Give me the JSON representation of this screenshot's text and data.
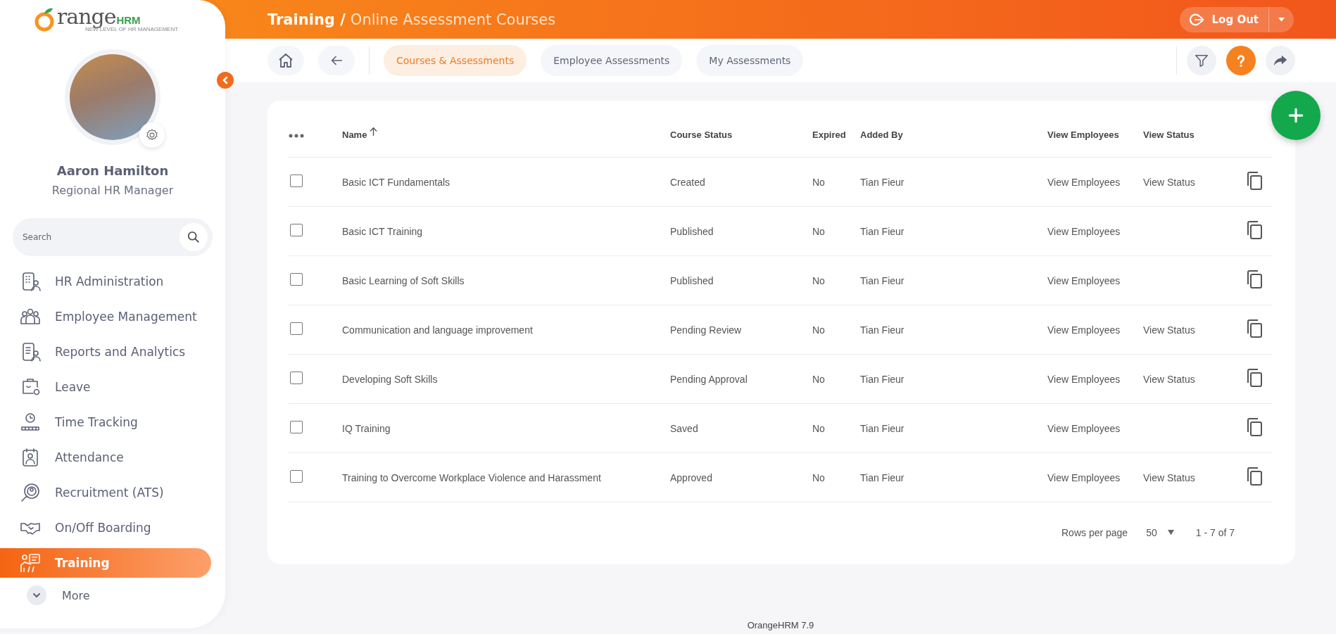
{
  "logo": {
    "brand": "range",
    "suffix": "HRM",
    "tagline": "NEW LEVEL OF HR MANAGEMENT"
  },
  "user": {
    "name": "Aaron Hamilton",
    "role": "Regional HR Manager"
  },
  "sidebar": {
    "search": {
      "placeholder": "Search"
    },
    "items": [
      {
        "label": "HR Administration",
        "selected": false
      },
      {
        "label": "Employee Management",
        "selected": false
      },
      {
        "label": "Reports and Analytics",
        "selected": false
      },
      {
        "label": "Leave",
        "selected": false
      },
      {
        "label": "Time Tracking",
        "selected": false
      },
      {
        "label": "Attendance",
        "selected": false
      },
      {
        "label": "Recruitment (ATS)",
        "selected": false
      },
      {
        "label": "On/Off Boarding",
        "selected": false
      },
      {
        "label": "Training",
        "selected": true
      }
    ],
    "more": {
      "label": "More"
    }
  },
  "header": {
    "section": "Training /",
    "page": "Online Assessment Courses",
    "logout": "Log Out"
  },
  "tabs": [
    {
      "label": "Courses & Assessments",
      "selected": true
    },
    {
      "label": "Employee Assessments",
      "selected": false
    },
    {
      "label": "My Assessments",
      "selected": false
    }
  ],
  "table": {
    "columns": [
      {
        "label": "Name",
        "sorted": true
      },
      {
        "label": "Course Status",
        "sorted": false
      },
      {
        "label": "Expired",
        "sorted": false
      },
      {
        "label": "Added By",
        "sorted": false
      },
      {
        "label": "View Employees",
        "sorted": false
      },
      {
        "label": "View Status",
        "sorted": false
      }
    ],
    "rows": [
      {
        "checked": false,
        "name": "Basic ICT Fundamentals",
        "status": "Created",
        "expired": "No",
        "added_by": "Tian Fieur",
        "view_employees": "View Employees",
        "view_status": "View Status"
      },
      {
        "checked": false,
        "name": "Basic ICT Training",
        "status": "Published",
        "expired": "No",
        "added_by": "Tian Fieur",
        "view_employees": "View Employees"
      },
      {
        "checked": false,
        "name": "Basic Learning of Soft Skills",
        "status": "Published",
        "expired": "No",
        "added_by": "Tian Fieur",
        "view_employees": "View Employees"
      },
      {
        "checked": false,
        "name": "Communication and language improvement",
        "status": "Pending Review",
        "expired": "No",
        "added_by": "Tian Fieur",
        "view_employees": "View Employees",
        "view_status": "View Status"
      },
      {
        "checked": false,
        "name": "Developing Soft Skills",
        "status": "Pending Approval",
        "expired": "No",
        "added_by": "Tian Fieur",
        "view_employees": "View Employees",
        "view_status": "View Status"
      },
      {
        "checked": false,
        "name": "IQ Training",
        "status": "Saved",
        "expired": "No",
        "added_by": "Tian Fieur",
        "view_employees": "View Employees"
      },
      {
        "checked": false,
        "name": "Training to Overcome Workplace Violence and Harassment",
        "status": "Approved",
        "expired": "No",
        "added_by": "Tian Fieur",
        "view_employees": "View Employees",
        "view_status": "View Status"
      }
    ]
  },
  "pagination": {
    "label": "Rows per page",
    "page_size": "50",
    "range": "1 - 7 of 7"
  },
  "footer": "OrangeHRM 7.9"
}
